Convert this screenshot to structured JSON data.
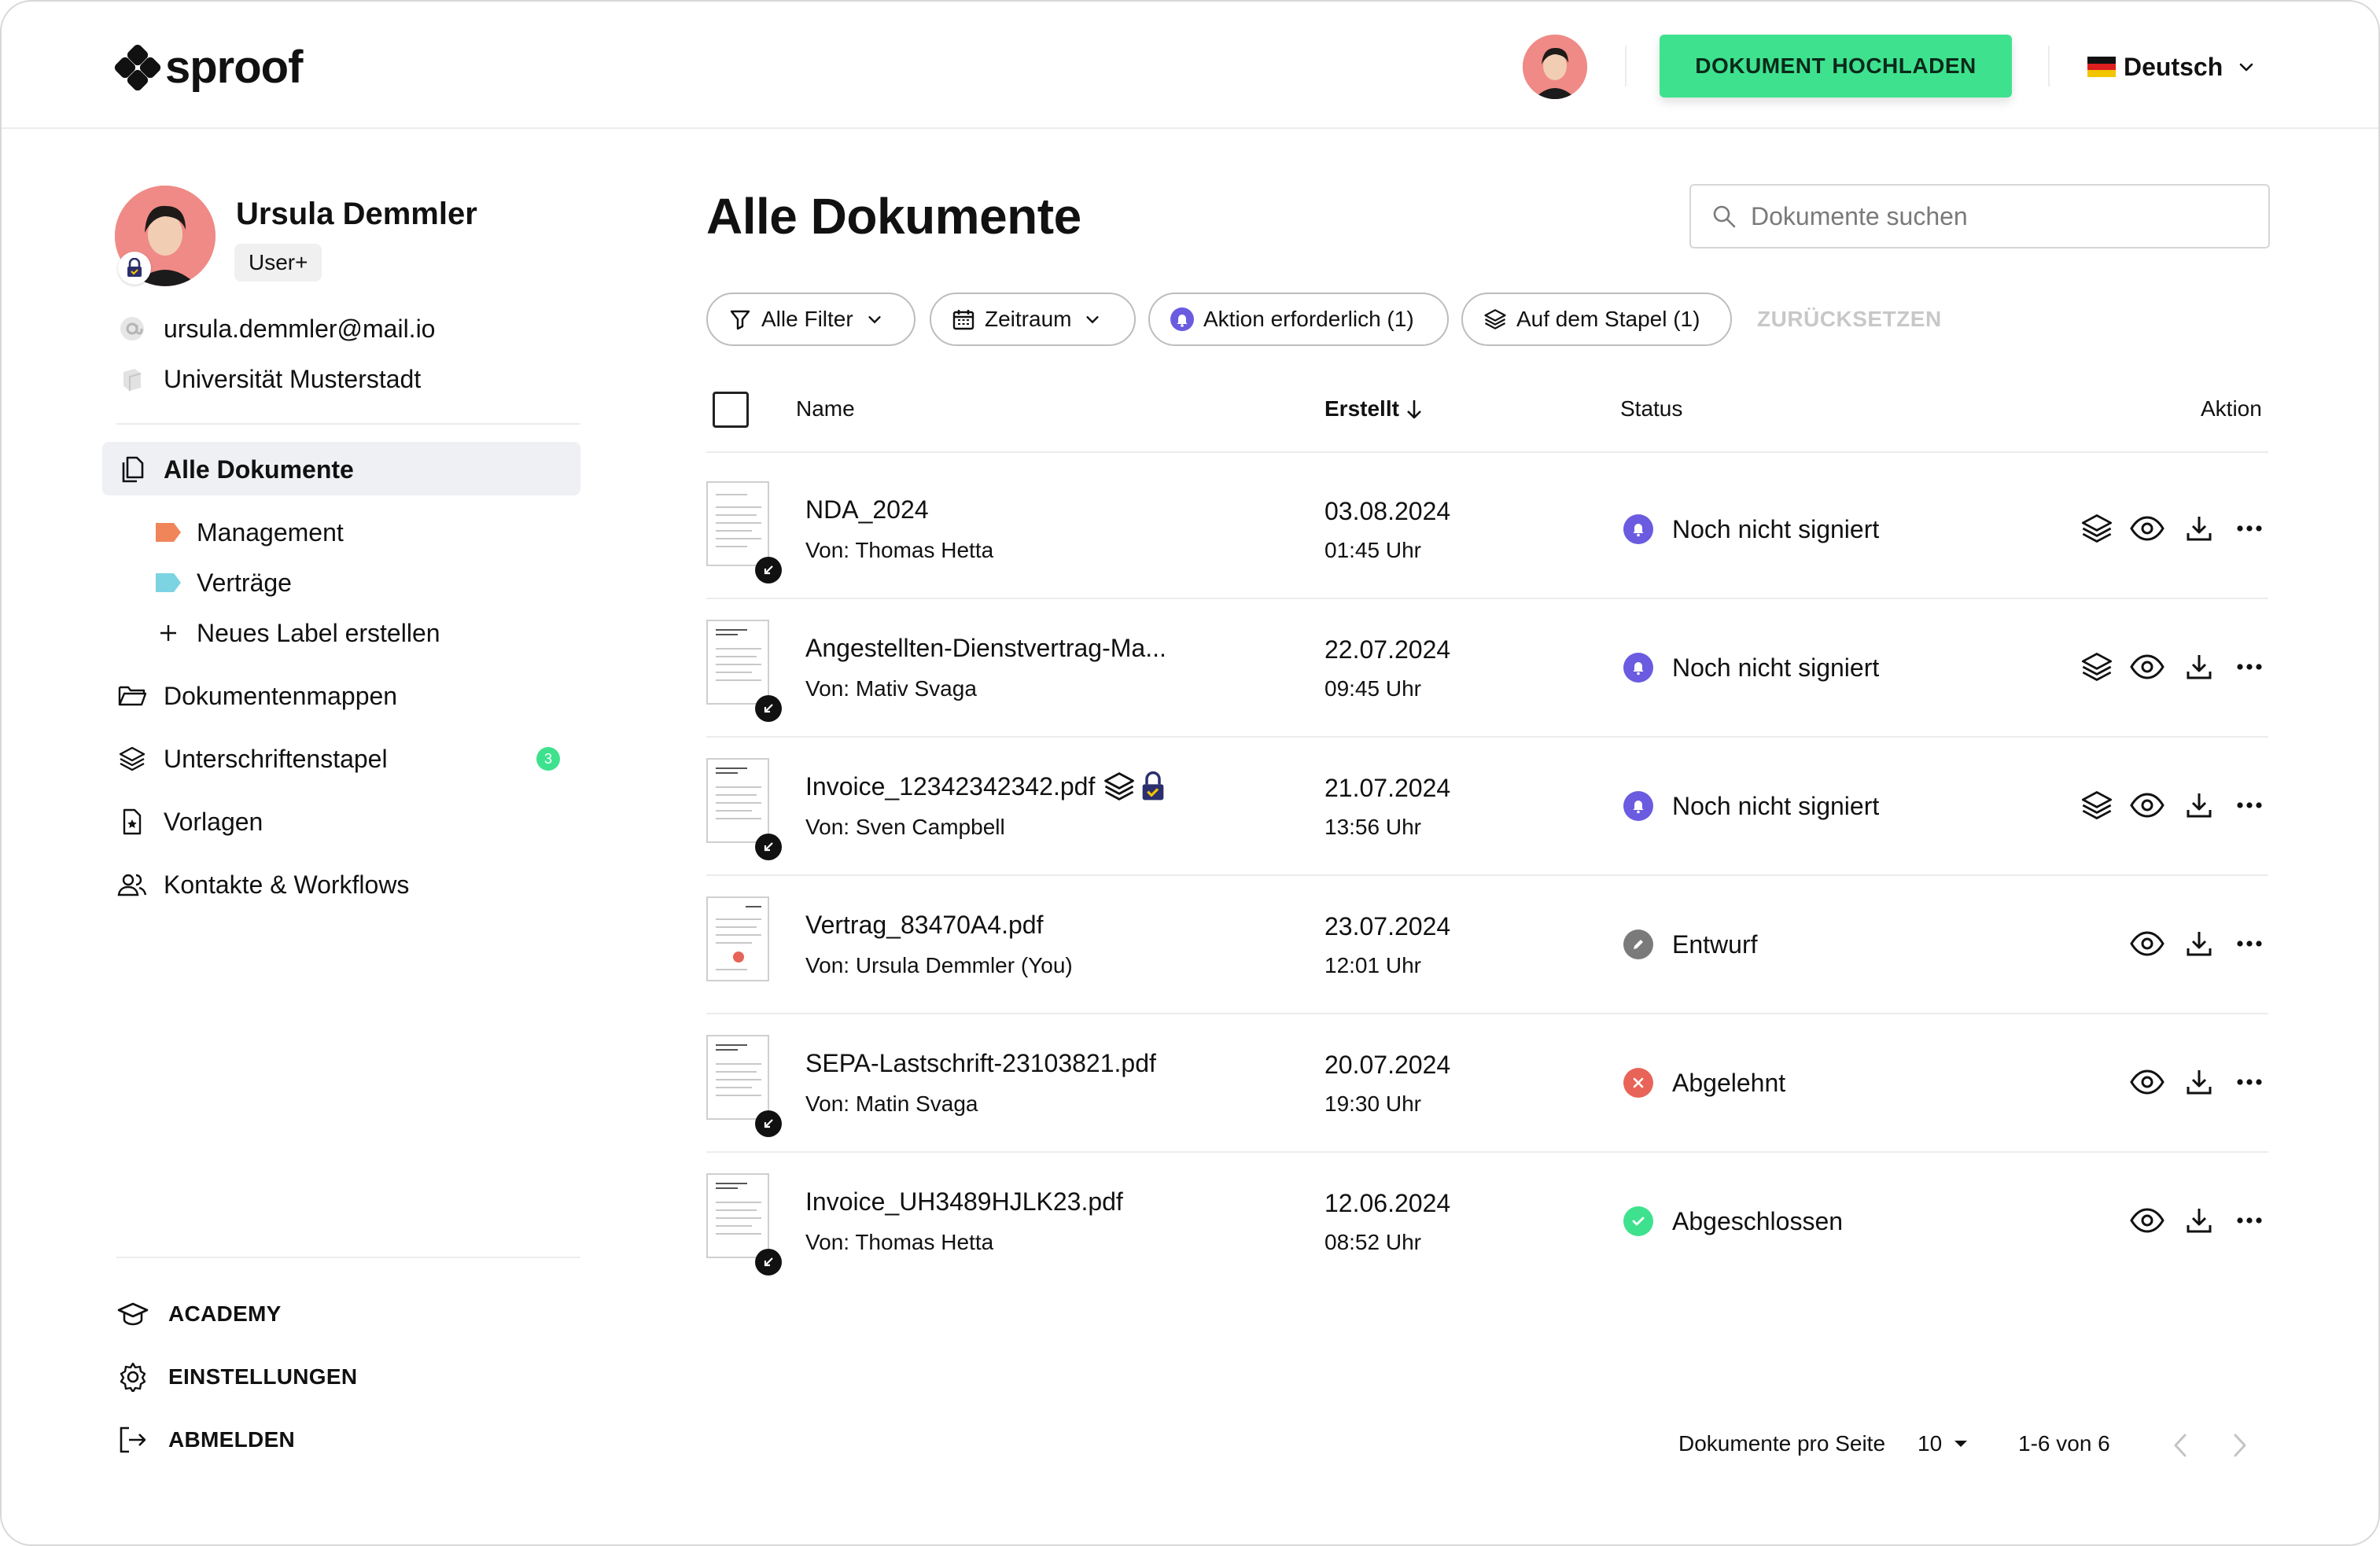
{
  "brand": {
    "name": "sproof"
  },
  "header": {
    "upload_label": "DOKUMENT HOCHLADEN",
    "language": "Deutsch"
  },
  "profile": {
    "name": "Ursula Demmler",
    "role": "User+",
    "email": "ursula.demmler@mail.io",
    "organization": "Universität Musterstadt"
  },
  "sidebar": {
    "all_documents": "Alle Dokumente",
    "labels": [
      {
        "label": "Management",
        "color": "#f0855a"
      },
      {
        "label": "Verträge",
        "color": "#7cd3e2"
      }
    ],
    "new_label": "Neues Label erstellen",
    "folders": "Dokumentenmappen",
    "signature_stack": "Unterschriftenstapel",
    "signature_stack_count": "3",
    "templates": "Vorlagen",
    "contacts": "Kontakte & Workflows",
    "academy": "ACADEMY",
    "settings": "EINSTELLUNGEN",
    "logout": "ABMELDEN"
  },
  "main": {
    "title": "Alle Dokumente",
    "search_placeholder": "Dokumente suchen",
    "filters": {
      "all": "Alle Filter",
      "period": "Zeitraum",
      "action": "Aktion erforderlich (1)",
      "stack": "Auf dem Stapel (1)",
      "reset": "ZURÜCKSETZEN"
    },
    "columns": {
      "name": "Name",
      "created": "Erstellt",
      "status": "Status",
      "action": "Aktion"
    },
    "rows": [
      {
        "name": "NDA_2024",
        "from": "Von: Thomas Hetta",
        "date": "03.08.2024",
        "time": "01:45 Uhr",
        "status": "Noch nicht signiert"
      },
      {
        "name": "Angestellten-Dienstvertrag-Ma...",
        "from": "Von: Mativ Svaga",
        "date": "22.07.2024",
        "time": "09:45 Uhr",
        "status": "Noch nicht signiert"
      },
      {
        "name": "Invoice_12342342342.pdf",
        "from": "Von: Sven Campbell",
        "date": "21.07.2024",
        "time": "13:56 Uhr",
        "status": "Noch nicht signiert"
      },
      {
        "name": "Vertrag_83470A4.pdf",
        "from": "Von: Ursula Demmler (You)",
        "date": "23.07.2024",
        "time": "12:01 Uhr",
        "status": "Entwurf"
      },
      {
        "name": "SEPA-Lastschrift-23103821.pdf",
        "from": "Von: Matin Svaga",
        "date": "20.07.2024",
        "time": "19:30 Uhr",
        "status": "Abgelehnt"
      },
      {
        "name": "Invoice_UH3489HJLK23.pdf",
        "from": "Von: Thomas Hetta",
        "date": "12.06.2024",
        "time": "08:52 Uhr",
        "status": "Abgeschlossen"
      }
    ],
    "pagination": {
      "per_page_label": "Dokumente pro Seite",
      "per_page": "10",
      "range": "1-6 von 6"
    }
  },
  "colors": {
    "accent": "#3ee28e",
    "pending": "#6a5be0",
    "draft": "#7a7a7a",
    "rejected": "#e86458",
    "done": "#3ee28e"
  },
  "icons": [
    "search-icon",
    "filter-icon",
    "calendar-icon",
    "bell-icon",
    "stack-icon",
    "eye-icon",
    "download-icon",
    "more-icon",
    "lock-icon",
    "chevron-down-icon",
    "chevron-left-icon",
    "chevron-right-icon"
  ]
}
